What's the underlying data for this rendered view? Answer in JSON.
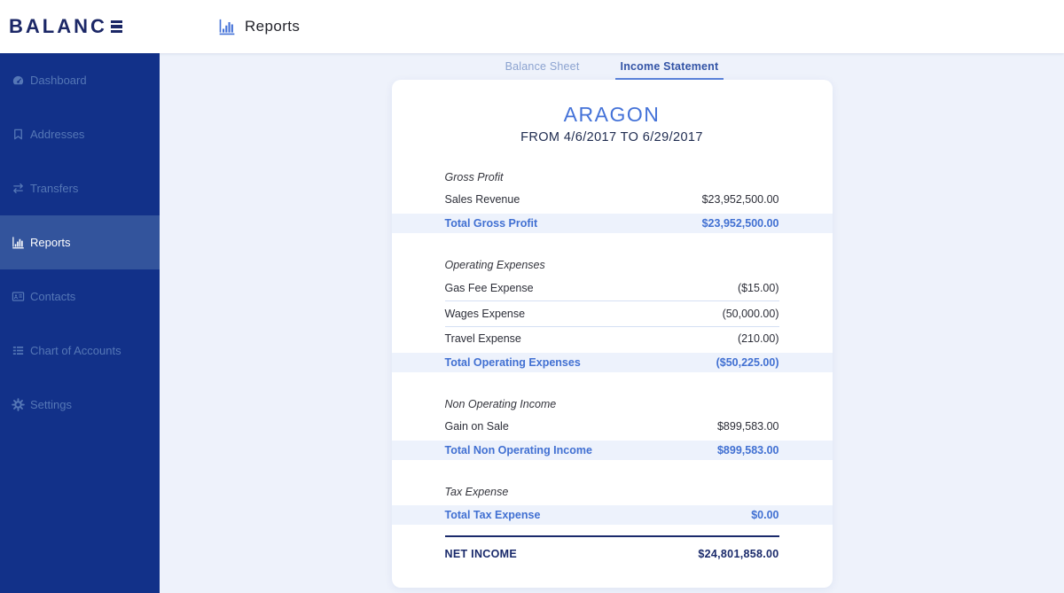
{
  "header": {
    "logo_text": "BALANC",
    "page_title": "Reports"
  },
  "sidebar": {
    "items": [
      {
        "label": "Dashboard",
        "icon": "dashboard-icon",
        "active": false
      },
      {
        "label": "Addresses",
        "icon": "bookmark-icon",
        "active": false
      },
      {
        "label": "Transfers",
        "icon": "transfers-icon",
        "active": false
      },
      {
        "label": "Reports",
        "icon": "bar-chart-icon",
        "active": true
      },
      {
        "label": "Contacts",
        "icon": "contacts-icon",
        "active": false
      },
      {
        "label": "Chart of Accounts",
        "icon": "list-icon",
        "active": false
      },
      {
        "label": "Settings",
        "icon": "gear-icon",
        "active": false
      }
    ]
  },
  "tabs": [
    {
      "label": "Balance Sheet",
      "active": false
    },
    {
      "label": "Income Statement",
      "active": true
    }
  ],
  "report": {
    "company": "ARAGON",
    "period": "FROM 4/6/2017 TO 6/29/2017",
    "sections": [
      {
        "heading": "Gross Profit",
        "rows": [
          {
            "label": "Sales Revenue",
            "value": "$23,952,500.00"
          }
        ],
        "total": {
          "label": "Total Gross Profit",
          "value": "$23,952,500.00"
        }
      },
      {
        "heading": "Operating Expenses",
        "rows": [
          {
            "label": "Gas Fee Expense",
            "value": "($15.00)"
          },
          {
            "label": "Wages Expense",
            "value": "(50,000.00)"
          },
          {
            "label": "Travel Expense",
            "value": "(210.00)"
          }
        ],
        "total": {
          "label": "Total Operating Expenses",
          "value": "($50,225.00)"
        }
      },
      {
        "heading": "Non Operating Income",
        "rows": [
          {
            "label": "Gain on Sale",
            "value": "$899,583.00"
          }
        ],
        "total": {
          "label": "Total Non Operating Income",
          "value": "$899,583.00"
        }
      },
      {
        "heading": "Tax Expense",
        "rows": [],
        "total": {
          "label": "Total Tax Expense",
          "value": "$0.00"
        }
      }
    ],
    "net_income": {
      "label": "NET INCOME",
      "value": "$24,801,858.00"
    }
  },
  "colors": {
    "sidebar_bg": "#123189",
    "sidebar_active_bg": "#33549C",
    "sidebar_text": "#5577B6",
    "sidebar_active_text": "#FFFFFF",
    "logo_navy": "#1B2766",
    "accent_blue": "#4472D8",
    "content_bg": "#EEF2FB",
    "total_row_bg": "#EDF2FC",
    "total_row_text": "#4170D2",
    "divider": "#D5E0F4",
    "net_income_navy": "#1A2A6B",
    "tab_active": "#3354A6",
    "tab_inactive": "#8CA3D0",
    "tab_underline": "#5B83DB",
    "body_text": "#2C2E38"
  }
}
